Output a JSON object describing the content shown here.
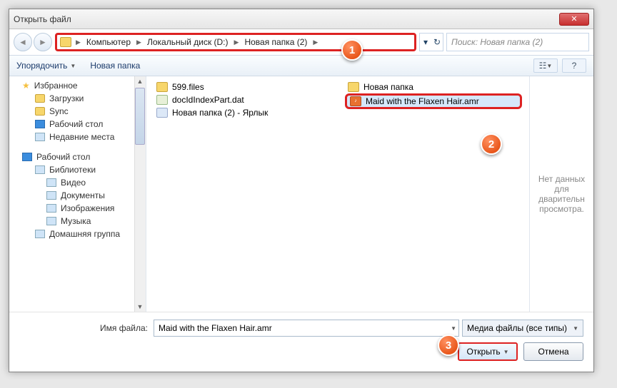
{
  "window": {
    "title": "Открыть файл"
  },
  "breadcrumb": [
    "Компьютер",
    "Локальный диск (D:)",
    "Новая папка (2)"
  ],
  "search": {
    "placeholder": "Поиск: Новая папка (2)"
  },
  "toolbar": {
    "organize": "Упорядочить",
    "newfolder": "Новая папка"
  },
  "sidebar": {
    "favorites": "Избранное",
    "downloads": "Загрузки",
    "sync": "Sync",
    "desktop": "Рабочий стол",
    "recent": "Недавние места",
    "desktop2": "Рабочий стол",
    "libraries": "Библиотеки",
    "video": "Видео",
    "documents": "Документы",
    "pictures": "Изображения",
    "music": "Музыка",
    "homegroup": "Домашняя группа"
  },
  "files": {
    "col1": [
      {
        "name": "599.files",
        "icon": "folder"
      },
      {
        "name": "docIdIndexPart.dat",
        "icon": "dat"
      },
      {
        "name": "Новая папка (2) - Ярлык",
        "icon": "lnk"
      }
    ],
    "col2": [
      {
        "name": "Новая папка",
        "icon": "folder"
      },
      {
        "name": "Maid with the Flaxen Hair.amr",
        "icon": "amr",
        "selected": true,
        "highlighted": true
      }
    ]
  },
  "preview": "Нет данных для дварительн просмотра.",
  "footer": {
    "filename_label": "Имя файла:",
    "filename_value": "Maid with the Flaxen Hair.amr",
    "filetype": "Медиа файлы (все типы)",
    "open": "Открыть",
    "cancel": "Отмена"
  },
  "badges": [
    "1",
    "2",
    "3"
  ]
}
